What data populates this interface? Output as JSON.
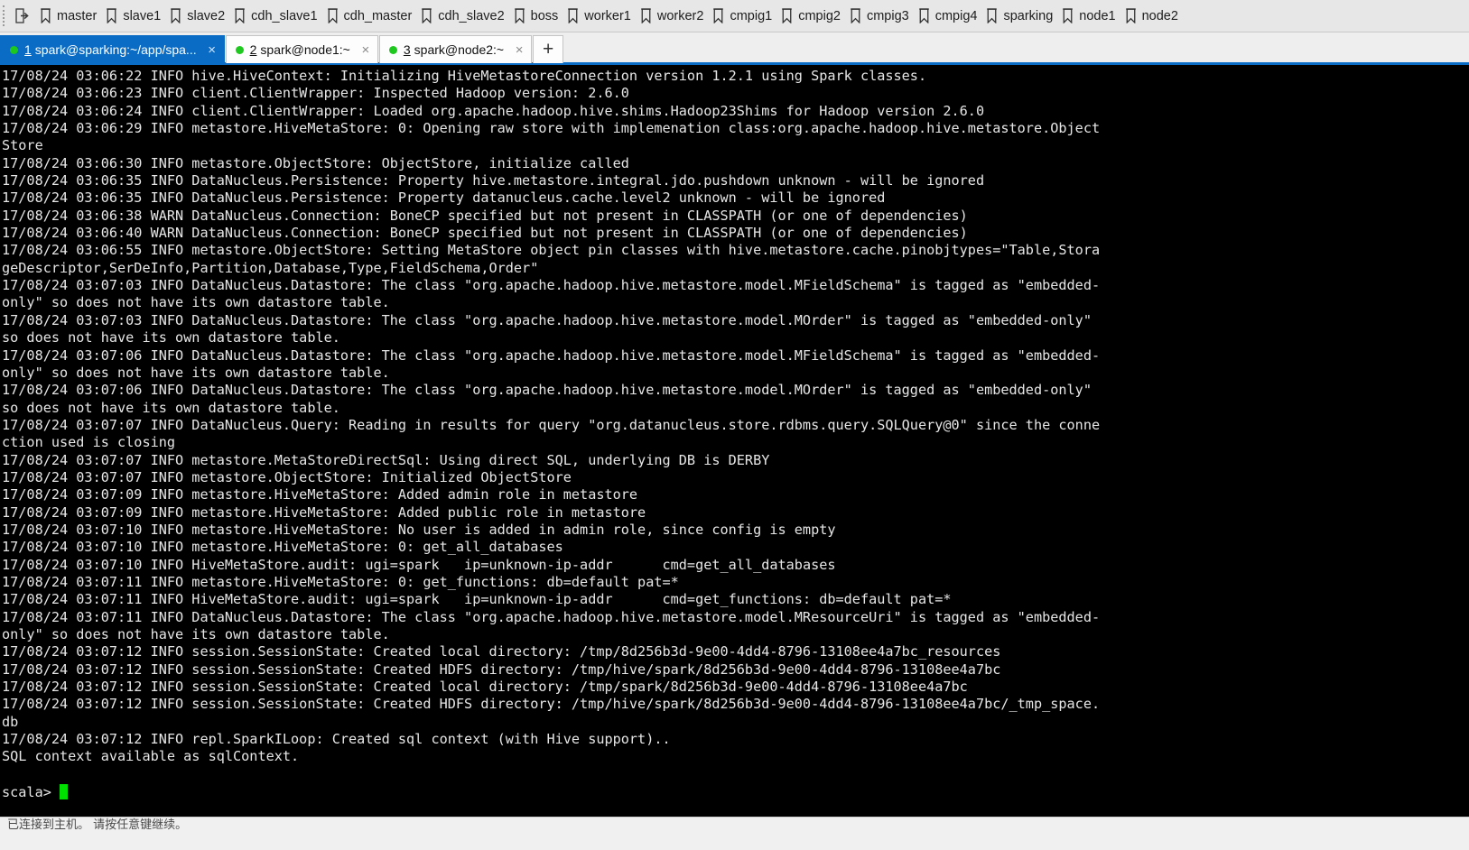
{
  "bookmark_bar": {
    "first_icon": "open-in-new-window-icon",
    "items": [
      {
        "label": "master",
        "icon": "bookmark-icon"
      },
      {
        "label": "slave1",
        "icon": "bookmark-icon"
      },
      {
        "label": "slave2",
        "icon": "bookmark-icon"
      },
      {
        "label": "cdh_slave1",
        "icon": "bookmark-icon"
      },
      {
        "label": "cdh_master",
        "icon": "bookmark-icon"
      },
      {
        "label": "cdh_slave2",
        "icon": "bookmark-icon"
      },
      {
        "label": "boss",
        "icon": "bookmark-icon"
      },
      {
        "label": "worker1",
        "icon": "bookmark-icon"
      },
      {
        "label": "worker2",
        "icon": "bookmark-icon"
      },
      {
        "label": "cmpig1",
        "icon": "bookmark-icon"
      },
      {
        "label": "cmpig2",
        "icon": "bookmark-icon"
      },
      {
        "label": "cmpig3",
        "icon": "bookmark-icon"
      },
      {
        "label": "cmpig4",
        "icon": "bookmark-icon"
      },
      {
        "label": "sparking",
        "icon": "bookmark-icon"
      },
      {
        "label": "node1",
        "icon": "bookmark-icon"
      },
      {
        "label": "node2",
        "icon": "bookmark-icon"
      }
    ]
  },
  "tabs": {
    "new_tab_label": "+",
    "close_glyph": "×",
    "active_color": "#0a6cc4",
    "status_dot_color": "#1ec81e",
    "items": [
      {
        "number": "1",
        "title": "spark@sparking:~/app/spa...",
        "active": true
      },
      {
        "number": "2",
        "title": "spark@node1:~",
        "active": false
      },
      {
        "number": "3",
        "title": "spark@node2:~",
        "active": false
      }
    ]
  },
  "terminal": {
    "background": "#000000",
    "foreground": "#e6e6e6",
    "cursor_color": "#00e000",
    "prompt": "scala>",
    "lines": [
      "17/08/24 03:06:22 INFO hive.HiveContext: Initializing HiveMetastoreConnection version 1.2.1 using Spark classes.",
      "17/08/24 03:06:23 INFO client.ClientWrapper: Inspected Hadoop version: 2.6.0",
      "17/08/24 03:06:24 INFO client.ClientWrapper: Loaded org.apache.hadoop.hive.shims.Hadoop23Shims for Hadoop version 2.6.0",
      "17/08/24 03:06:29 INFO metastore.HiveMetaStore: 0: Opening raw store with implemenation class:org.apache.hadoop.hive.metastore.Object",
      "Store",
      "17/08/24 03:06:30 INFO metastore.ObjectStore: ObjectStore, initialize called",
      "17/08/24 03:06:35 INFO DataNucleus.Persistence: Property hive.metastore.integral.jdo.pushdown unknown - will be ignored",
      "17/08/24 03:06:35 INFO DataNucleus.Persistence: Property datanucleus.cache.level2 unknown - will be ignored",
      "17/08/24 03:06:38 WARN DataNucleus.Connection: BoneCP specified but not present in CLASSPATH (or one of dependencies)",
      "17/08/24 03:06:40 WARN DataNucleus.Connection: BoneCP specified but not present in CLASSPATH (or one of dependencies)",
      "17/08/24 03:06:55 INFO metastore.ObjectStore: Setting MetaStore object pin classes with hive.metastore.cache.pinobjtypes=\"Table,Stora",
      "geDescriptor,SerDeInfo,Partition,Database,Type,FieldSchema,Order\"",
      "17/08/24 03:07:03 INFO DataNucleus.Datastore: The class \"org.apache.hadoop.hive.metastore.model.MFieldSchema\" is tagged as \"embedded-",
      "only\" so does not have its own datastore table.",
      "17/08/24 03:07:03 INFO DataNucleus.Datastore: The class \"org.apache.hadoop.hive.metastore.model.MOrder\" is tagged as \"embedded-only\"",
      "so does not have its own datastore table.",
      "17/08/24 03:07:06 INFO DataNucleus.Datastore: The class \"org.apache.hadoop.hive.metastore.model.MFieldSchema\" is tagged as \"embedded-",
      "only\" so does not have its own datastore table.",
      "17/08/24 03:07:06 INFO DataNucleus.Datastore: The class \"org.apache.hadoop.hive.metastore.model.MOrder\" is tagged as \"embedded-only\"",
      "so does not have its own datastore table.",
      "17/08/24 03:07:07 INFO DataNucleus.Query: Reading in results for query \"org.datanucleus.store.rdbms.query.SQLQuery@0\" since the conne",
      "ction used is closing",
      "17/08/24 03:07:07 INFO metastore.MetaStoreDirectSql: Using direct SQL, underlying DB is DERBY",
      "17/08/24 03:07:07 INFO metastore.ObjectStore: Initialized ObjectStore",
      "17/08/24 03:07:09 INFO metastore.HiveMetaStore: Added admin role in metastore",
      "17/08/24 03:07:09 INFO metastore.HiveMetaStore: Added public role in metastore",
      "17/08/24 03:07:10 INFO metastore.HiveMetaStore: No user is added in admin role, since config is empty",
      "17/08/24 03:07:10 INFO metastore.HiveMetaStore: 0: get_all_databases",
      "17/08/24 03:07:10 INFO HiveMetaStore.audit: ugi=spark\tip=unknown-ip-addr\tcmd=get_all_databases",
      "17/08/24 03:07:11 INFO metastore.HiveMetaStore: 0: get_functions: db=default pat=*",
      "17/08/24 03:07:11 INFO HiveMetaStore.audit: ugi=spark\tip=unknown-ip-addr\tcmd=get_functions: db=default pat=*",
      "17/08/24 03:07:11 INFO DataNucleus.Datastore: The class \"org.apache.hadoop.hive.metastore.model.MResourceUri\" is tagged as \"embedded-",
      "only\" so does not have its own datastore table.",
      "17/08/24 03:07:12 INFO session.SessionState: Created local directory: /tmp/8d256b3d-9e00-4dd4-8796-13108ee4a7bc_resources",
      "17/08/24 03:07:12 INFO session.SessionState: Created HDFS directory: /tmp/hive/spark/8d256b3d-9e00-4dd4-8796-13108ee4a7bc",
      "17/08/24 03:07:12 INFO session.SessionState: Created local directory: /tmp/spark/8d256b3d-9e00-4dd4-8796-13108ee4a7bc",
      "17/08/24 03:07:12 INFO session.SessionState: Created HDFS directory: /tmp/hive/spark/8d256b3d-9e00-4dd4-8796-13108ee4a7bc/_tmp_space.",
      "db",
      "17/08/24 03:07:12 INFO repl.SparkILoop: Created sql context (with Hive support)..",
      "SQL context available as sqlContext.",
      ""
    ]
  },
  "status_bar": {
    "text": "已连接到主机。 请按任意键继续。"
  }
}
